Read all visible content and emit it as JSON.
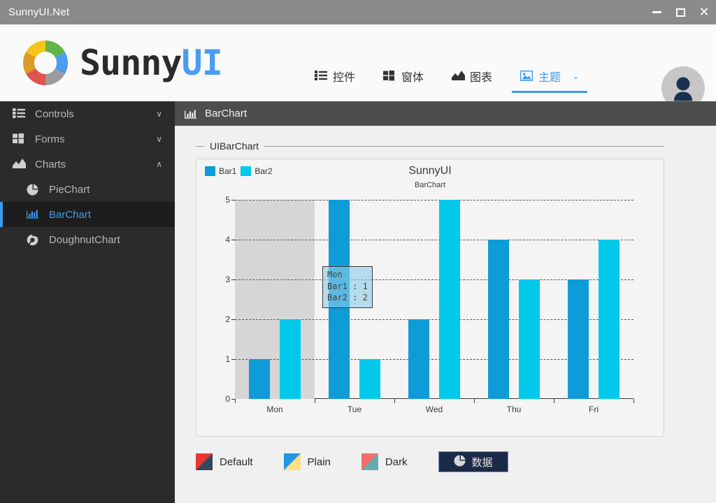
{
  "window": {
    "title": "SunnyUI.Net",
    "buttons": [
      {
        "name": "minimize-button",
        "icon": "minimize-icon"
      },
      {
        "name": "maximize-button",
        "icon": "maximize-icon"
      },
      {
        "name": "close-button",
        "icon": "close-icon",
        "glyph": "✕"
      }
    ]
  },
  "brand": {
    "text_primary": "Sunny",
    "text_accent": "UI"
  },
  "nav": {
    "items": [
      {
        "label": "控件",
        "icon": "list-icon",
        "active": false
      },
      {
        "label": "窗体",
        "icon": "windows-icon",
        "active": false
      },
      {
        "label": "图表",
        "icon": "area-chart-icon",
        "active": false
      },
      {
        "label": "主题",
        "icon": "image-icon",
        "active": true,
        "chevron": "⌄"
      }
    ]
  },
  "sidebar": {
    "items": [
      {
        "label": "Controls",
        "icon": "list-icon",
        "chevron": "∨",
        "level": 1,
        "active": false
      },
      {
        "label": "Forms",
        "icon": "windows-icon",
        "chevron": "∨",
        "level": 1,
        "active": false
      },
      {
        "label": "Charts",
        "icon": "area-chart-icon",
        "chevron": "∧",
        "level": 1,
        "active": false
      },
      {
        "label": "PieChart",
        "icon": "pie-chart-icon",
        "chevron": "",
        "level": 2,
        "active": false
      },
      {
        "label": "BarChart",
        "icon": "bar-chart-icon",
        "chevron": "",
        "level": 2,
        "active": true
      },
      {
        "label": "DoughnutChart",
        "icon": "doughnut-chart-icon",
        "chevron": "",
        "level": 2,
        "active": false
      }
    ]
  },
  "page_header": {
    "title": "BarChart",
    "icon": "bar-chart-icon"
  },
  "groupbox": {
    "title": "UIBarChart"
  },
  "theme_row": {
    "options": [
      {
        "label": "Default",
        "color_from": "#e8372f",
        "color_to": "#31495e"
      },
      {
        "label": "Plain",
        "color_from": "#2196e3",
        "color_to": "#ffe082"
      },
      {
        "label": "Dark",
        "color_from": "#f2706b",
        "color_to": "#63adad"
      }
    ],
    "data_button": {
      "label": "数据",
      "icon": "pie-chart-icon",
      "bg": "#1b2a47"
    }
  },
  "colors": {
    "accent": "#3d9bee",
    "bar1": "#0d9cd8",
    "bar2": "#00c8ea",
    "sidebar_bg": "#2b2b2b",
    "titlebar_bg": "#8a8a8a",
    "page_header_bg": "#4d4d4d",
    "highlight_band": "#d6d6d6"
  },
  "chart_data": {
    "type": "bar",
    "title": "SunnyUI",
    "subtitle": "BarChart",
    "xlabel": "",
    "ylabel": "",
    "categories": [
      "Mon",
      "Tue",
      "Wed",
      "Thu",
      "Fri"
    ],
    "ylim": [
      0,
      5
    ],
    "yticks": [
      0,
      1,
      2,
      3,
      4,
      5
    ],
    "grid": true,
    "legend_position": "top-left",
    "series": [
      {
        "name": "Bar1",
        "color": "#0d9cd8",
        "values": [
          1,
          5,
          2,
          4,
          3
        ]
      },
      {
        "name": "Bar2",
        "color": "#00c8ea",
        "values": [
          2,
          1,
          5,
          3,
          4
        ]
      }
    ],
    "highlighted_category": "Mon",
    "tooltip": {
      "category": "Mon",
      "lines": [
        "Mon",
        "Bar1 : 1",
        "Bar2 : 2"
      ]
    }
  }
}
